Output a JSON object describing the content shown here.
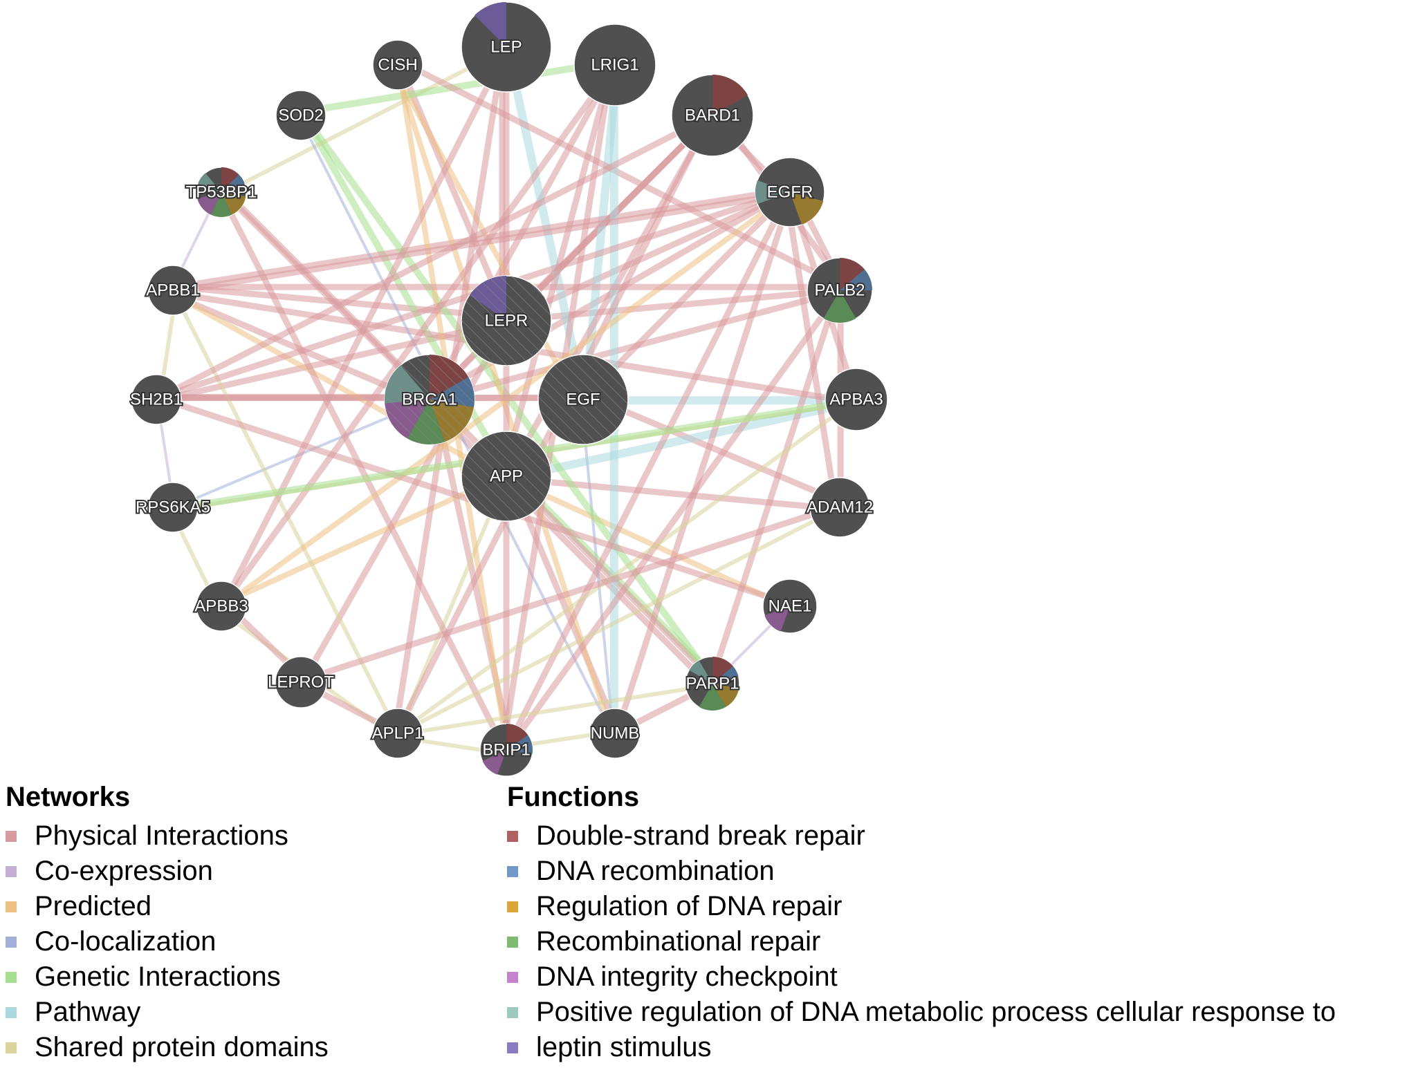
{
  "networks_legend": {
    "title": "Networks",
    "items": [
      {
        "label": "Physical Interactions",
        "color": "#d89a9f"
      },
      {
        "label": "Co-expression",
        "color": "#c4b0d6"
      },
      {
        "label": "Predicted",
        "color": "#ecc184"
      },
      {
        "label": "Co-localization",
        "color": "#a2b0da"
      },
      {
        "label": "Genetic Interactions",
        "color": "#a6e08e"
      },
      {
        "label": "Pathway",
        "color": "#a9d8df"
      },
      {
        "label": "Shared protein domains",
        "color": "#d9d39c"
      }
    ]
  },
  "functions_legend": {
    "title": "Functions",
    "items": [
      {
        "label": "Double-strand break repair",
        "color": "#b06060"
      },
      {
        "label": "DNA recombination",
        "color": "#7198c8"
      },
      {
        "label": "Regulation of DNA repair",
        "color": "#dba63a"
      },
      {
        "label": "Recombinational repair",
        "color": "#7fbb6f"
      },
      {
        "label": "DNA integrity checkpoint",
        "color": "#c483cc"
      },
      {
        "label": "Positive regulation of DNA metabolic process cellular response to",
        "color": "#9ccabd"
      },
      {
        "label": "leptin stimulus",
        "color": "#8a7ac2"
      }
    ]
  },
  "node_fill": "#505050",
  "pie_colors": {
    "dsb": "#7e4444",
    "recomb": "#4f6f93",
    "reg": "#967a30",
    "recrep": "#5a8a55",
    "check": "#8a5b8e",
    "pos": "#6c8f89",
    "leptin": "#6b5b96"
  },
  "nodes": [
    {
      "id": "LEP",
      "query": false,
      "size": "large",
      "functions": [
        "leptin"
      ]
    },
    {
      "id": "CISH",
      "query": false,
      "size": "small",
      "functions": []
    },
    {
      "id": "LRIG1",
      "query": false,
      "size": "large",
      "functions": []
    },
    {
      "id": "SOD2",
      "query": false,
      "size": "small",
      "functions": []
    },
    {
      "id": "BARD1",
      "query": false,
      "size": "large",
      "functions": [
        "dsb"
      ]
    },
    {
      "id": "TP53BP1",
      "query": false,
      "size": "small",
      "functions": [
        "dsb",
        "recomb",
        "reg",
        "recrep",
        "check",
        "pos"
      ]
    },
    {
      "id": "EGFR",
      "query": false,
      "size": "medium",
      "functions": [
        "reg",
        "pos"
      ]
    },
    {
      "id": "APBB1",
      "query": false,
      "size": "small",
      "functions": []
    },
    {
      "id": "PALB2",
      "query": false,
      "size": "medium",
      "functions": [
        "dsb",
        "recomb",
        "recrep"
      ]
    },
    {
      "id": "LEPR",
      "query": true,
      "size": "query",
      "functions": [
        "leptin"
      ]
    },
    {
      "id": "SH2B1",
      "query": false,
      "size": "small",
      "functions": []
    },
    {
      "id": "BRCA1",
      "query": true,
      "size": "query",
      "functions": [
        "dsb",
        "recomb",
        "reg",
        "recrep",
        "check",
        "pos"
      ]
    },
    {
      "id": "EGF",
      "query": true,
      "size": "query",
      "functions": []
    },
    {
      "id": "APBA3",
      "query": false,
      "size": "medium",
      "functions": []
    },
    {
      "id": "APP",
      "query": true,
      "size": "query",
      "functions": []
    },
    {
      "id": "RPS6KA5",
      "query": false,
      "size": "small",
      "functions": []
    },
    {
      "id": "ADAM12",
      "query": false,
      "size": "medium",
      "functions": []
    },
    {
      "id": "APBB3",
      "query": false,
      "size": "small",
      "functions": []
    },
    {
      "id": "NAE1",
      "query": false,
      "size": "small",
      "functions": [
        "check"
      ]
    },
    {
      "id": "LEPROT",
      "query": false,
      "size": "small",
      "functions": []
    },
    {
      "id": "PARP1",
      "query": false,
      "size": "small",
      "functions": [
        "dsb",
        "recomb",
        "reg",
        "recrep",
        "pos"
      ]
    },
    {
      "id": "APLP1",
      "query": false,
      "size": "small",
      "functions": []
    },
    {
      "id": "BRIP1",
      "query": false,
      "size": "small",
      "functions": [
        "dsb",
        "recomb",
        "check"
      ]
    },
    {
      "id": "NUMB",
      "query": false,
      "size": "small",
      "functions": []
    }
  ],
  "edges": [
    [
      "BRCA1",
      "BARD1",
      "physical"
    ],
    [
      "BRCA1",
      "BARD1",
      "physical"
    ],
    [
      "BRCA1",
      "PALB2",
      "physical"
    ],
    [
      "BRCA1",
      "BRIP1",
      "physical"
    ],
    [
      "BRCA1",
      "TP53BP1",
      "physical"
    ],
    [
      "BRCA1",
      "PARP1",
      "physical"
    ],
    [
      "BRCA1",
      "EGFR",
      "physical"
    ],
    [
      "BRCA1",
      "LRIG1",
      "physical"
    ],
    [
      "BRCA1",
      "APBB1",
      "physical"
    ],
    [
      "BRCA1",
      "SH2B1",
      "physical"
    ],
    [
      "BRCA1",
      "RPS6KA5",
      "colocalization"
    ],
    [
      "LEPR",
      "LEP",
      "physical"
    ],
    [
      "LEPR",
      "CISH",
      "physical"
    ],
    [
      "LEPR",
      "SH2B1",
      "physical"
    ],
    [
      "LEPR",
      "LEPROT",
      "physical"
    ],
    [
      "LEPR",
      "EGFR",
      "physical"
    ],
    [
      "LEPR",
      "BARD1",
      "physical"
    ],
    [
      "LEPR",
      "APBB1",
      "physical"
    ],
    [
      "LEPR",
      "PALB2",
      "physical"
    ],
    [
      "EGF",
      "EGFR",
      "physical"
    ],
    [
      "EGF",
      "LRIG1",
      "pathway"
    ],
    [
      "EGF",
      "APBA3",
      "pathway"
    ],
    [
      "EGF",
      "CISH",
      "predicted"
    ],
    [
      "EGF",
      "SH2B1",
      "physical"
    ],
    [
      "EGF",
      "NUMB",
      "colocalization"
    ],
    [
      "EGF",
      "ADAM12",
      "physical"
    ],
    [
      "EGF",
      "LEP",
      "pathway"
    ],
    [
      "APP",
      "APBB1",
      "predicted"
    ],
    [
      "APP",
      "APBB3",
      "predicted"
    ],
    [
      "APP",
      "APLP1",
      "shared"
    ],
    [
      "APP",
      "APBA3",
      "pathway"
    ],
    [
      "APP",
      "NUMB",
      "physical"
    ],
    [
      "APP",
      "NAE1",
      "predicted"
    ],
    [
      "APP",
      "LRIG1",
      "physical"
    ],
    [
      "APP",
      "SOD2",
      "genetic"
    ],
    [
      "APP",
      "ADAM12",
      "physical"
    ],
    [
      "APP",
      "PARP1",
      "genetic"
    ],
    [
      "APP",
      "BARD1",
      "physical"
    ],
    [
      "APBB1",
      "APBA3",
      "physical"
    ],
    [
      "APBB1",
      "EGFR",
      "physical"
    ],
    [
      "APBB1",
      "APLP1",
      "shared"
    ],
    [
      "APBB3",
      "APLP1",
      "shared"
    ],
    [
      "TP53BP1",
      "PARP1",
      "physical"
    ],
    [
      "TP53BP1",
      "BRIP1",
      "physical"
    ],
    [
      "TP53BP1",
      "LEP",
      "shared"
    ],
    [
      "SOD2",
      "PARP1",
      "genetic"
    ],
    [
      "SOD2",
      "NUMB",
      "colocalization"
    ],
    [
      "SOD2",
      "LRIG1",
      "genetic"
    ],
    [
      "CISH",
      "BRIP1",
      "predicted"
    ],
    [
      "CISH",
      "NUMB",
      "predicted"
    ],
    [
      "CISH",
      "PALB2",
      "physical"
    ],
    [
      "LEP",
      "BRIP1",
      "physical"
    ],
    [
      "LEP",
      "APLP1",
      "physical"
    ],
    [
      "LEP",
      "APBB3",
      "physical"
    ],
    [
      "LRIG1",
      "NUMB",
      "pathway"
    ],
    [
      "LRIG1",
      "BRIP1",
      "physical"
    ],
    [
      "LRIG1",
      "APBB3",
      "physical"
    ],
    [
      "BARD1",
      "EGFR",
      "physical"
    ],
    [
      "BARD1",
      "PALB2",
      "physical"
    ],
    [
      "BARD1",
      "SH2B1",
      "physical"
    ],
    [
      "BARD1",
      "APLP1",
      "physical"
    ],
    [
      "EGFR",
      "PALB2",
      "physical"
    ],
    [
      "EGFR",
      "APBA3",
      "physical"
    ],
    [
      "EGFR",
      "ADAM12",
      "physical"
    ],
    [
      "EGFR",
      "NUMB",
      "physical"
    ],
    [
      "EGFR",
      "BRIP1",
      "physical"
    ],
    [
      "EGFR",
      "APBB3",
      "predicted"
    ],
    [
      "EGFR",
      "SH2B1",
      "physical"
    ],
    [
      "EGFR",
      "APBB1",
      "physical"
    ],
    [
      "PALB2",
      "BRIP1",
      "physical"
    ],
    [
      "PALB2",
      "ADAM12",
      "physical"
    ],
    [
      "PALB2",
      "PARP1",
      "physical"
    ],
    [
      "PALB2",
      "APBB1",
      "physical"
    ],
    [
      "APBA3",
      "APLP1",
      "shared"
    ],
    [
      "APBA3",
      "RPS6KA5",
      "shared"
    ],
    [
      "ADAM12",
      "LEPROT",
      "physical"
    ],
    [
      "ADAM12",
      "APLP1",
      "shared"
    ],
    [
      "NAE1",
      "PARP1",
      "coexpression"
    ],
    [
      "NAE1",
      "SH2B1",
      "physical"
    ],
    [
      "PARP1",
      "APLP1",
      "shared"
    ],
    [
      "APBB1",
      "SH2B1",
      "shared"
    ],
    [
      "SH2B1",
      "RPS6KA5",
      "coexpression"
    ],
    [
      "RPS6KA5",
      "APBB3",
      "shared"
    ],
    [
      "APBB3",
      "LEPROT",
      "physical"
    ],
    [
      "LEPROT",
      "APLP1",
      "physical"
    ],
    [
      "APLP1",
      "BRIP1",
      "shared"
    ],
    [
      "BRIP1",
      "NUMB",
      "shared"
    ],
    [
      "NUMB",
      "PARP1",
      "physical"
    ],
    [
      "TP53BP1",
      "APBB1",
      "coexpression"
    ],
    [
      "SH2B1",
      "EGF",
      "physical"
    ],
    [
      "RPS6KA5",
      "APBA3",
      "genetic"
    ]
  ]
}
